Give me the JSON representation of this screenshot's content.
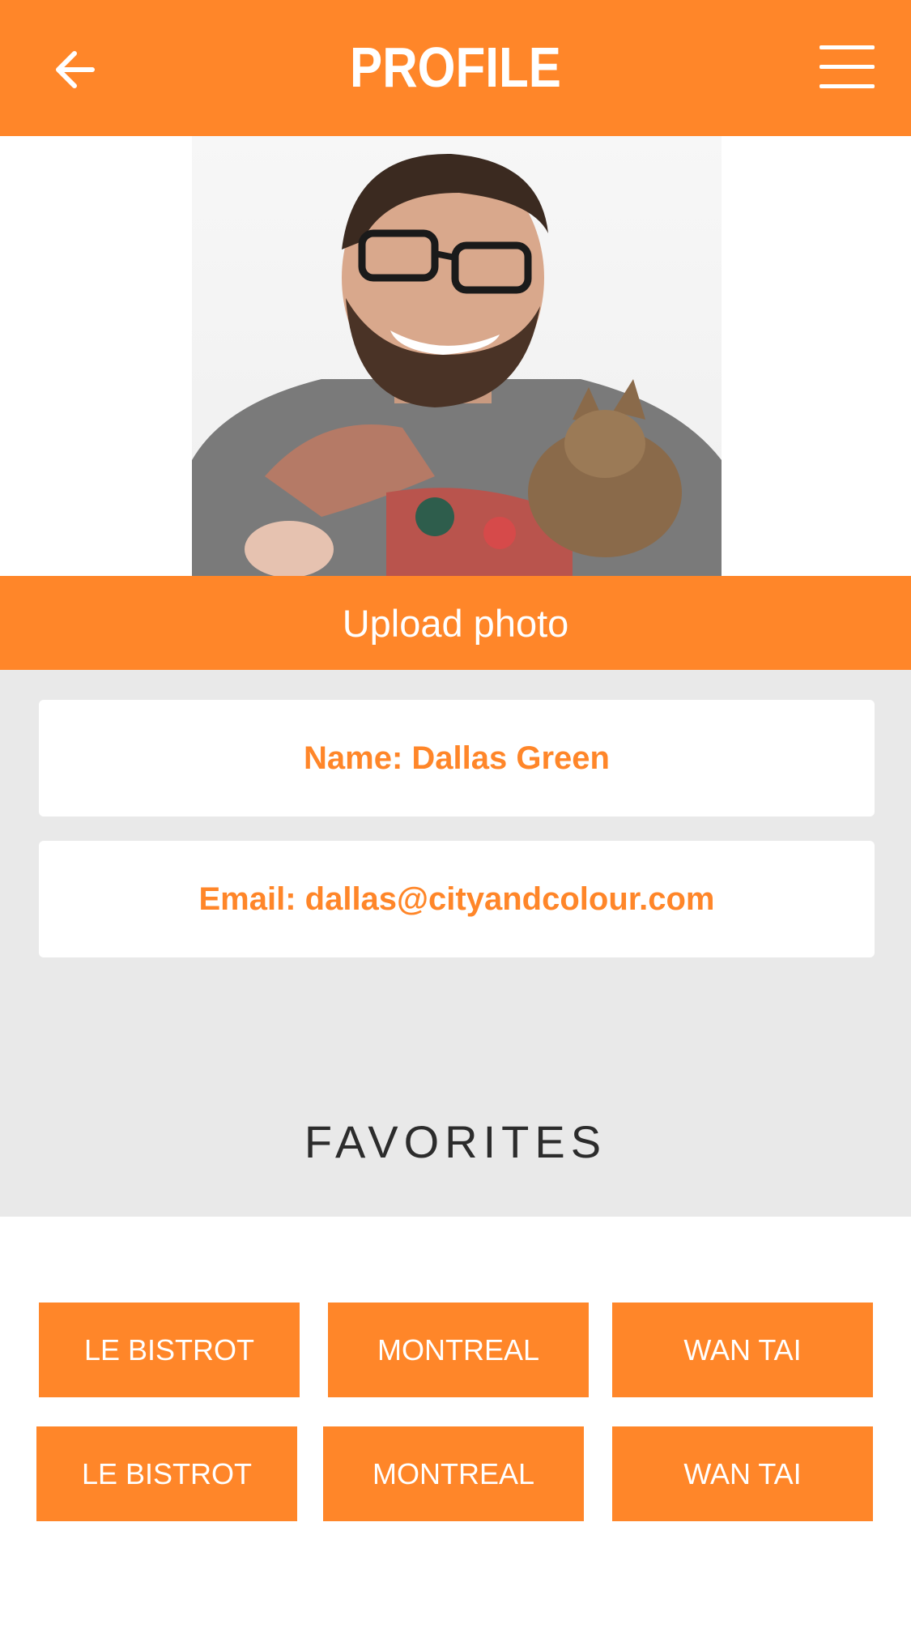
{
  "header": {
    "title": "PROFILE",
    "back_icon": "arrow-left-icon",
    "menu_icon": "hamburger-menu-icon"
  },
  "profile": {
    "photo_alt": "profile-photo",
    "upload_label": "Upload photo",
    "name_line": "Name: Dallas Green",
    "email_line": "Email: dallas@cityandcolour.com"
  },
  "favorites": {
    "title": "FAVORITES",
    "items": [
      "LE BISTROT",
      "MONTREAL",
      "WAN TAI",
      "LE BISTROT",
      "MONTREAL",
      "WAN TAI"
    ]
  },
  "colors": {
    "accent": "#FF8629",
    "section_bg": "#E9E9E9"
  }
}
